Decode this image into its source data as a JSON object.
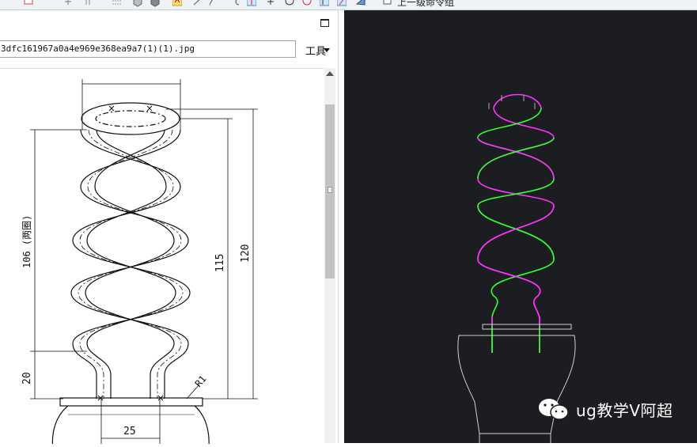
{
  "toolbar": {
    "icons": [
      "template-icon",
      "move-icon",
      "trim-icon",
      "grid-icon",
      "cube-icon",
      "cube-shaded-icon",
      "snap-icon",
      "line-icon",
      "arc-icon",
      "undo-icon",
      "pin-icon",
      "point-icon",
      "circle-icon",
      "target-icon",
      "pointer-icon",
      "eraser-icon",
      "shape-icon",
      "rename-icon"
    ],
    "label": "上一级命令组"
  },
  "image_viewer": {
    "file_path": "3dfc161967a0a4e969e368ea9a7(1)(1).jpg",
    "tools_menu": "工具"
  },
  "drawing": {
    "dim_106": "106 (两圈)",
    "dim_20": "20",
    "dim_115": "115",
    "dim_120": "120",
    "dim_25": "25",
    "dim_r1": "R1"
  },
  "colors": {
    "cad_background": "#1c1d20",
    "curve_magenta": "#ff33ff",
    "curve_green": "#33ff33",
    "outline_gray": "#cfcfcf"
  },
  "watermark": {
    "text": "ug教学V阿超"
  }
}
